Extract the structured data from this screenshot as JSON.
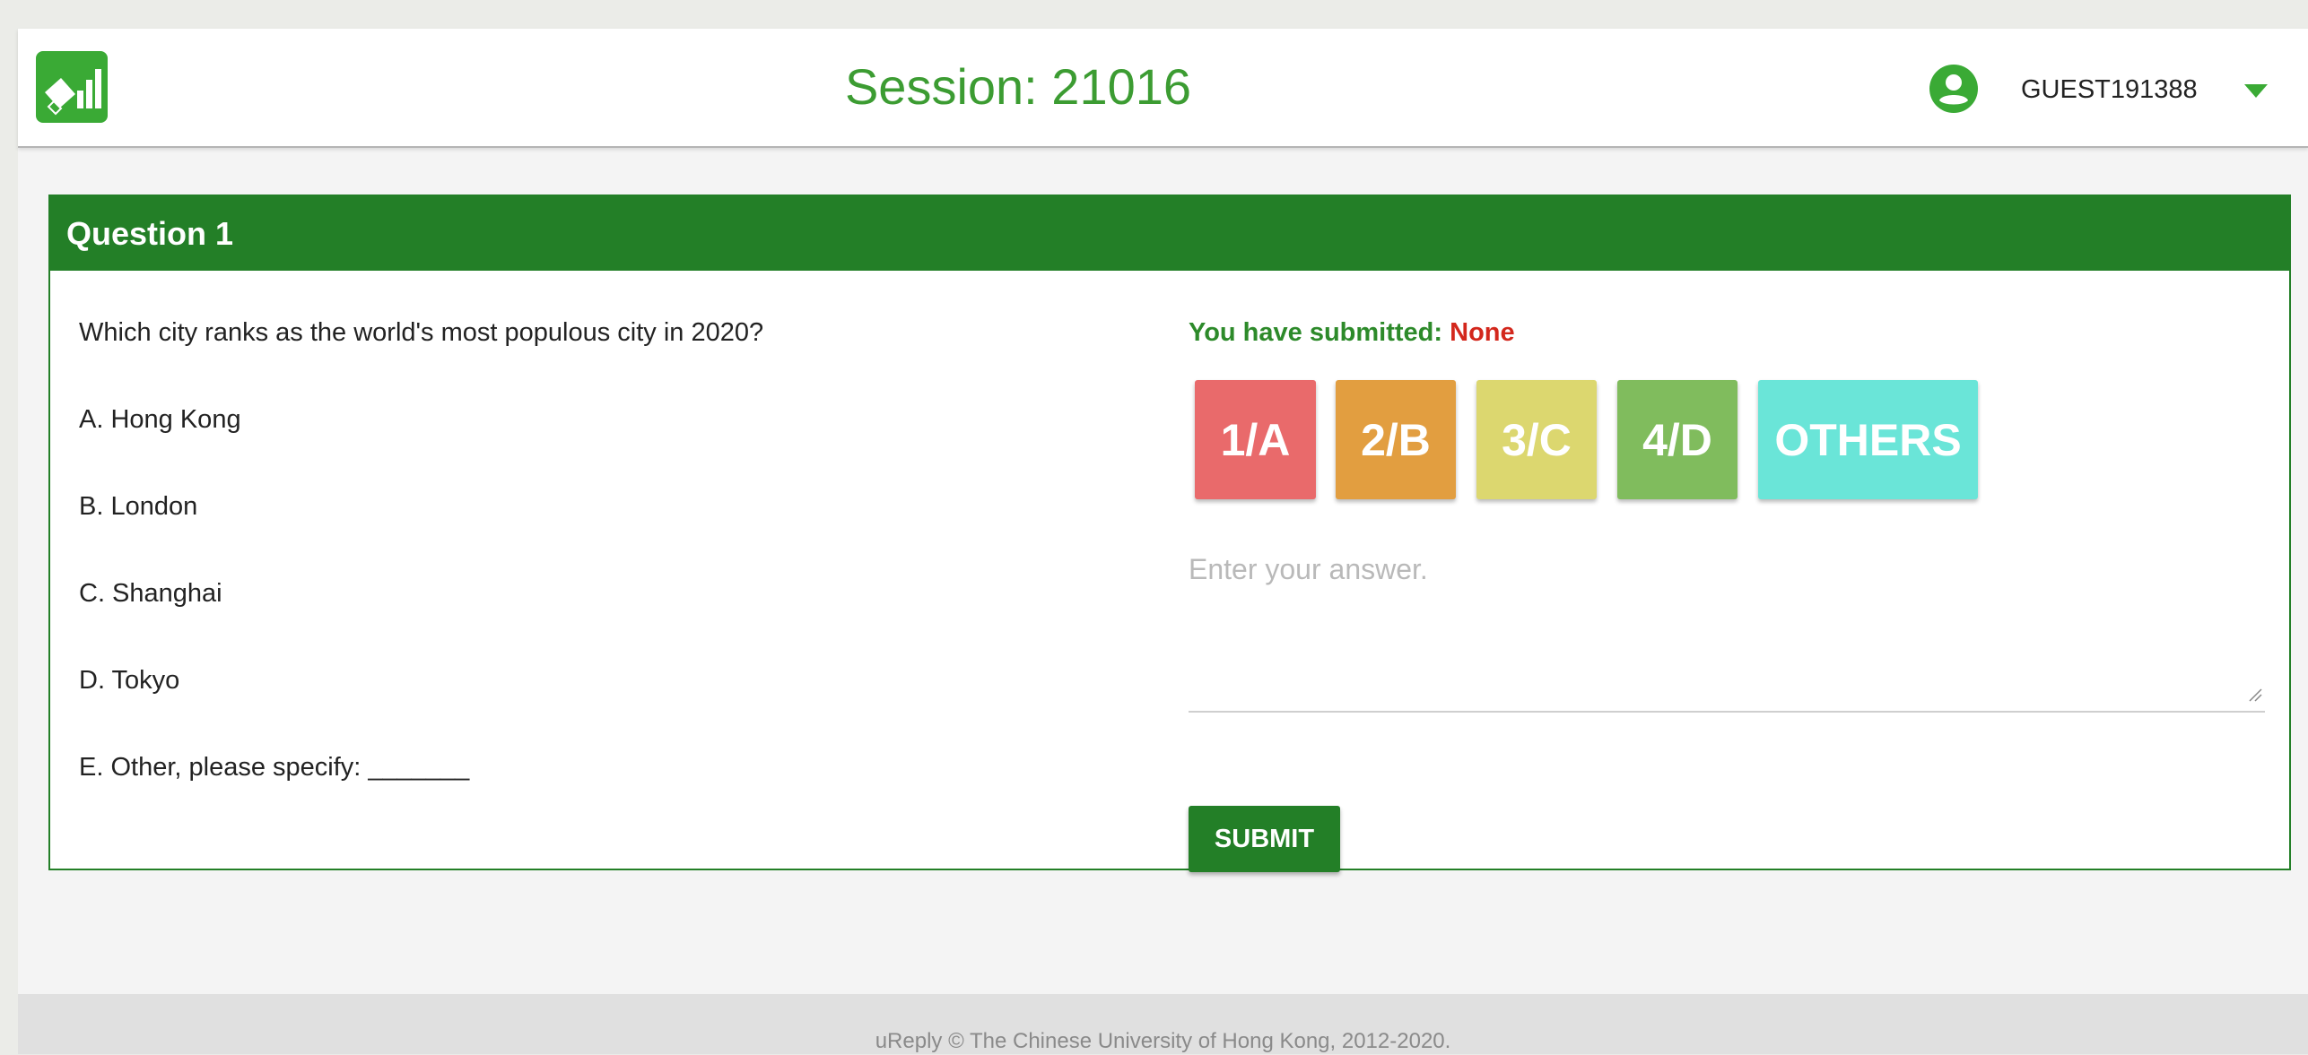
{
  "header": {
    "session_title": "Session: 21016",
    "username": "GUEST191388",
    "logo_icon": "chart-logo-icon",
    "user_icon": "account-circle-icon",
    "dropdown_icon": "caret-down-icon"
  },
  "question": {
    "title": "Question 1",
    "text": "Which city ranks as the world's most populous city in 2020?",
    "options": [
      "A. Hong Kong",
      "B. London",
      "C. Shanghai",
      "D. Tokyo",
      "E. Other, please specify: _______"
    ]
  },
  "response": {
    "submitted_label": "You have submitted:",
    "submitted_value": "None",
    "choices": [
      "1/A",
      "2/B",
      "3/C",
      "4/D",
      "OTHERS"
    ],
    "answer_placeholder": "Enter your answer.",
    "submit_label": "SUBMIT"
  },
  "footer": {
    "text": "uReply © The Chinese University of Hong Kong, 2012-2020."
  },
  "colors": {
    "brand_green": "#237f27",
    "title_green": "#3c9c32",
    "none_red": "#d3271c",
    "choice_a": "#e96a6b",
    "choice_b": "#e29e40",
    "choice_c": "#dcd76f",
    "choice_d": "#80bc5d",
    "choice_others": "#6ae5d8"
  }
}
